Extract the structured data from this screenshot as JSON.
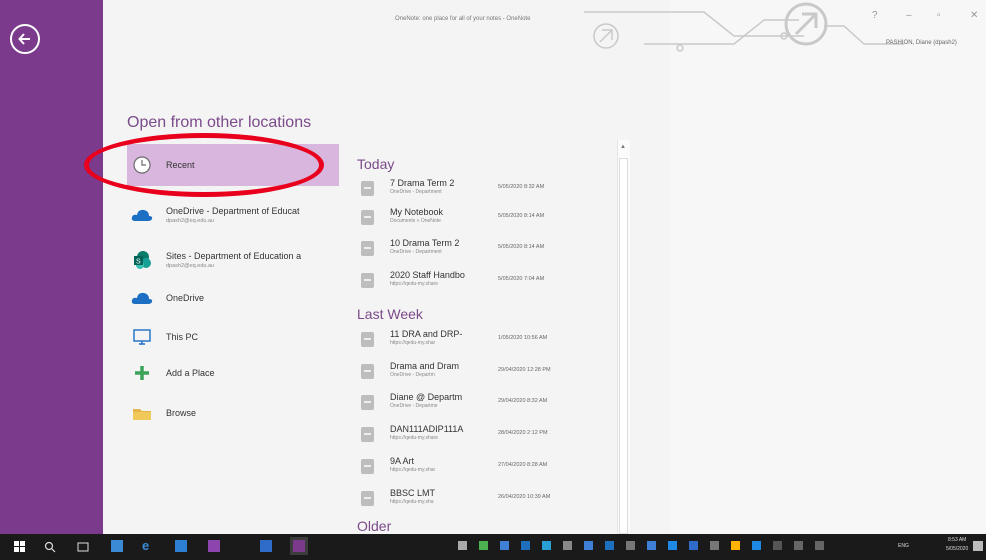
{
  "window": {
    "title": "OneNote: one place for all of your notes - OneNote",
    "user": "PASHION, Diane (dpash2)",
    "controls": {
      "help": "?",
      "minimize": "–",
      "restore": "▫",
      "close": "✕"
    }
  },
  "backstage": {
    "section_heading": "Open from other locations",
    "locations": [
      {
        "name": "Recent",
        "subtitle": "",
        "icon": "clock-icon"
      },
      {
        "name": "OneDrive - Department of Educat",
        "subtitle": "dpash2@eq.edu.au",
        "icon": "onedrive-cloud-icon"
      },
      {
        "name": "Sites - Department of Education a",
        "subtitle": "dpash2@eq.edu.au",
        "icon": "sharepoint-sites-icon"
      },
      {
        "name": "OneDrive",
        "subtitle": "",
        "icon": "onedrive-cloud-icon"
      },
      {
        "name": "This PC",
        "subtitle": "",
        "icon": "monitor-icon"
      },
      {
        "name": "Add a Place",
        "subtitle": "",
        "icon": "plus-icon"
      },
      {
        "name": "Browse",
        "subtitle": "",
        "icon": "folder-icon"
      }
    ],
    "selected_location": "Recent"
  },
  "recent_files": {
    "groups": [
      {
        "label": "Today",
        "items": [
          {
            "name": "7 Drama Term 2",
            "path": "OneDrive - Department",
            "date": "5/05/2020 8:32 AM"
          },
          {
            "name": "My Notebook",
            "path": "Documents » OneNote",
            "date": "5/05/2020 8:14 AM"
          },
          {
            "name": "10 Drama Term 2",
            "path": "OneDrive - Department",
            "date": "5/05/2020 8:14 AM"
          },
          {
            "name": "2020 Staff Handbo",
            "path": "https://qedu-my.share",
            "date": "5/05/2020 7:04 AM"
          }
        ]
      },
      {
        "label": "Last Week",
        "items": [
          {
            "name": "11 DRA and DRP-",
            "path": "https://qedu-my.shar",
            "date": "1/05/2020 10:56 AM"
          },
          {
            "name": "Drama and Dram",
            "path": "OneDrive - Departm",
            "date": "29/04/2020 12:28 PM"
          },
          {
            "name": "Diane @ Departm",
            "path": "OneDrive - Departme",
            "date": "29/04/2020 8:32 AM"
          },
          {
            "name": "DAN111ADIP111A",
            "path": "https://qedu-my.share",
            "date": "28/04/2020 2:12 PM"
          },
          {
            "name": "9A Art",
            "path": "https://qedu-my.shar",
            "date": "27/04/2020 8:28 AM"
          },
          {
            "name": "BBSC LMT",
            "path": "https://qedu-my.sha",
            "date": "26/04/2020 10:39 AM"
          }
        ]
      },
      {
        "label": "Older",
        "items": []
      }
    ]
  },
  "taskbar": {
    "language": "ENG",
    "time": "8:53 AM",
    "date": "5/05/2020",
    "icons": [
      "windows-start-icon",
      "search-icon",
      "task-view-icon",
      "store-icon",
      "edge-icon",
      "people-icon",
      "onenote-icon",
      "outlook-icon",
      "onenote-active-icon"
    ],
    "tray_icons": [
      "tray-icon-1",
      "tray-icon-2",
      "tray-icon-3",
      "tray-icon-4",
      "tray-icon-5",
      "tray-icon-6",
      "tray-icon-7",
      "tray-icon-8",
      "tray-icon-9",
      "tray-icon-10",
      "tray-icon-11",
      "tray-icon-12",
      "tray-icon-13",
      "tray-icon-14",
      "tray-icon-15",
      "tray-icon-16",
      "tray-icon-17",
      "tray-icon-18"
    ]
  },
  "colors": {
    "accent": "#7b3a8c",
    "selected": "#d8b6de",
    "annotation": "#e8001c"
  }
}
